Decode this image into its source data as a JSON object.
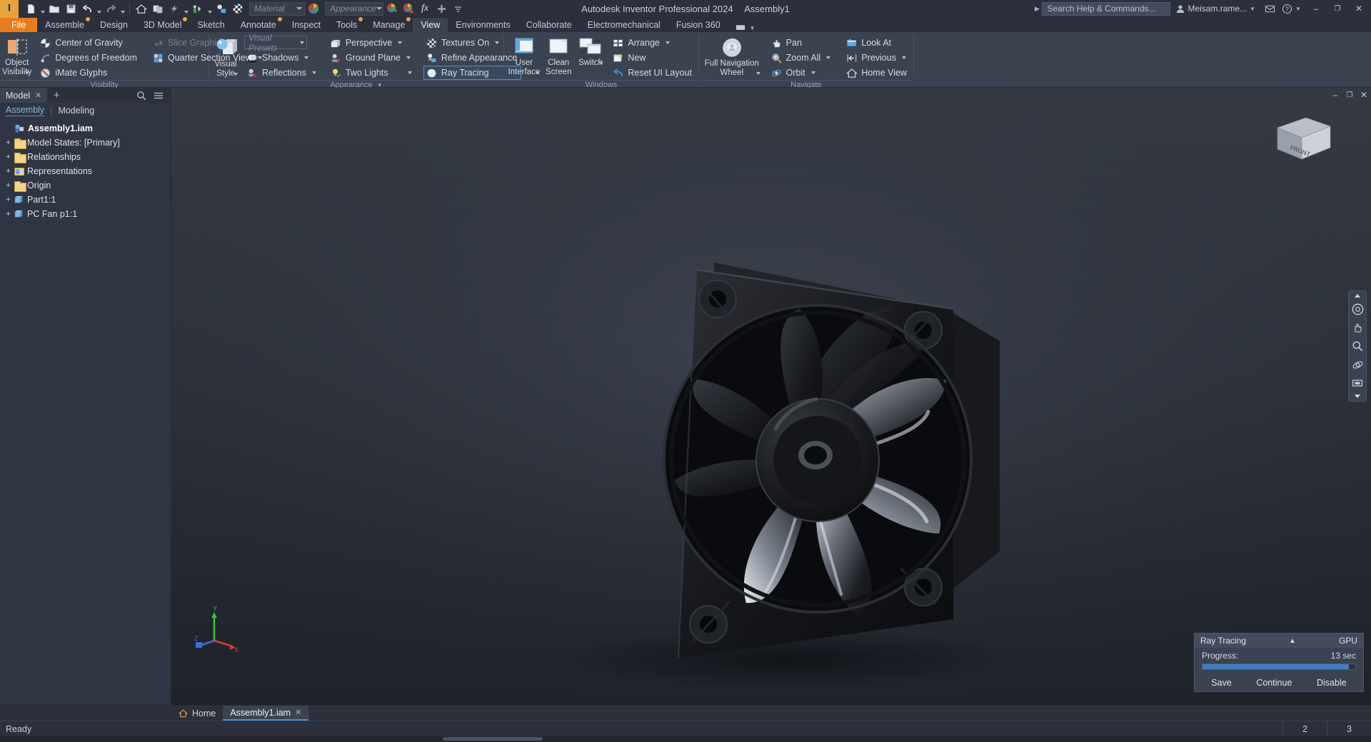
{
  "titlebar": {
    "logo": "I",
    "app_title": "Autodesk Inventor Professional 2024",
    "document_title": "Assembly1",
    "search_placeholder": "Search Help & Commands...",
    "user_name": "Meisam.rame...",
    "material_placeholder": "Material",
    "appearance_placeholder": "Appearance",
    "quick_access": [
      {
        "name": "new-file-icon",
        "label": "New"
      },
      {
        "name": "open-file-icon",
        "label": "Open"
      },
      {
        "name": "save-icon",
        "label": "Save"
      },
      {
        "name": "undo-icon",
        "label": "Undo"
      },
      {
        "name": "redo-icon",
        "label": "Redo"
      },
      {
        "name": "home-icon",
        "label": "Home"
      },
      {
        "name": "return-icon",
        "label": "Return"
      },
      {
        "name": "update-icon",
        "label": "Update"
      },
      {
        "name": "material-swatch-icon",
        "label": "Material Swatch"
      },
      {
        "name": "appearance-swatch-icon",
        "label": "Appearance Swatch"
      },
      {
        "name": "adjust-icon",
        "label": "Adjust"
      },
      {
        "name": "clear-appearance-icon",
        "label": "Clear Appearance"
      },
      {
        "name": "parameters-icon",
        "label": "fx"
      },
      {
        "name": "add-icon",
        "label": "Add"
      },
      {
        "name": "qat-overflow-icon",
        "label": "Customize"
      }
    ],
    "window_controls": {
      "minimize": "–",
      "maximize": "❐",
      "close": "✕"
    }
  },
  "ribbon": {
    "tabs": [
      {
        "label": "File",
        "kind": "file",
        "badge": false
      },
      {
        "label": "Assemble",
        "kind": "normal",
        "badge": true
      },
      {
        "label": "Design",
        "kind": "normal",
        "badge": false
      },
      {
        "label": "3D Model",
        "kind": "normal",
        "badge": true
      },
      {
        "label": "Sketch",
        "kind": "normal",
        "badge": false
      },
      {
        "label": "Annotate",
        "kind": "normal",
        "badge": true
      },
      {
        "label": "Inspect",
        "kind": "normal",
        "badge": false
      },
      {
        "label": "Tools",
        "kind": "normal",
        "badge": true
      },
      {
        "label": "Manage",
        "kind": "normal",
        "badge": true
      },
      {
        "label": "View",
        "kind": "active",
        "badge": false
      },
      {
        "label": "Environments",
        "kind": "normal",
        "badge": false
      },
      {
        "label": "Collaborate",
        "kind": "normal",
        "badge": false
      },
      {
        "label": "Electromechanical",
        "kind": "normal",
        "badge": false
      },
      {
        "label": "Fusion 360",
        "kind": "normal",
        "badge": false
      }
    ],
    "panels": {
      "visibility": {
        "title": "Visibility",
        "object_visibility": "Object\nVisibility",
        "object_visibility_l1": "Object",
        "object_visibility_l2": "Visibility",
        "items": [
          {
            "label": "Center of Gravity",
            "icon": "center-of-gravity-icon",
            "dim": false
          },
          {
            "label": "Degrees of Freedom",
            "icon": "degrees-of-freedom-icon",
            "dim": false
          },
          {
            "label": "iMate Glyphs",
            "icon": "imate-glyphs-icon",
            "dim": false
          },
          {
            "label": "Slice Graphics",
            "icon": "slice-graphics-icon",
            "dim": true
          },
          {
            "label": "Quarter Section View",
            "icon": "quarter-section-view-icon",
            "dim": false
          }
        ]
      },
      "appearance": {
        "title": "Appearance",
        "visual_style_l1": "Visual",
        "visual_style_l2": "Style",
        "visual_presets_placeholder": "Visual Presets",
        "items_col2": [
          {
            "label": "Shadows",
            "icon": "shadows-icon",
            "caret": true,
            "selected": false
          },
          {
            "label": "Reflections",
            "icon": "reflections-icon",
            "caret": true,
            "selected": false
          }
        ],
        "items_col3": [
          {
            "label": "Perspective",
            "icon": "perspective-icon",
            "caret": true,
            "selected": false
          },
          {
            "label": "Ground Plane",
            "icon": "ground-plane-icon",
            "caret": true,
            "selected": false
          },
          {
            "label": "Two Lights",
            "icon": "two-lights-icon",
            "caret": true,
            "selected": false
          }
        ],
        "items_col4": [
          {
            "label": "Textures On",
            "icon": "textures-on-icon",
            "caret": true,
            "selected": false
          },
          {
            "label": "Refine Appearance",
            "icon": "refine-appearance-icon",
            "caret": false,
            "selected": false
          },
          {
            "label": "Ray Tracing",
            "icon": "ray-tracing-icon",
            "caret": false,
            "selected": true
          }
        ]
      },
      "windows": {
        "title": "Windows",
        "user_interface_l1": "User",
        "user_interface_l2": "Interface",
        "clean_screen_l1": "Clean",
        "clean_screen_l2": "Screen",
        "switch_label": "Switch",
        "items": [
          {
            "label": "Arrange",
            "icon": "arrange-icon",
            "caret": true
          },
          {
            "label": "New",
            "icon": "new-window-icon",
            "caret": false
          },
          {
            "label": "Reset UI Layout",
            "icon": "reset-ui-layout-icon",
            "caret": false
          }
        ]
      },
      "navigate": {
        "title": "Navigate",
        "full_nav_l1": "Full Navigation",
        "full_nav_l2": "Wheel",
        "items_col1": [
          {
            "label": "Pan",
            "icon": "pan-icon",
            "caret": false
          },
          {
            "label": "Zoom All",
            "icon": "zoom-all-icon",
            "caret": true
          },
          {
            "label": "Orbit",
            "icon": "orbit-icon",
            "caret": true
          }
        ],
        "items_col2": [
          {
            "label": "Look At",
            "icon": "look-at-icon",
            "caret": false
          },
          {
            "label": "Previous",
            "icon": "previous-view-icon",
            "caret": true
          },
          {
            "label": "Home View",
            "icon": "home-view-icon",
            "caret": false
          }
        ]
      }
    }
  },
  "browser": {
    "tab_label": "Model",
    "close_glyph": "✕",
    "plus_glyph": "+",
    "search_icon": "search-icon",
    "menu_icon": "hamburger-menu-icon",
    "filter_assembly": "Assembly",
    "filter_separator": "|",
    "filter_modeling": "Modeling",
    "tree": [
      {
        "label": "Assembly1.iam",
        "level": 0,
        "expander": "",
        "icon": "assembly-icon",
        "root": true
      },
      {
        "label": "Model States: [Primary]",
        "level": 1,
        "expander": "+",
        "icon": "folder-icon",
        "root": false
      },
      {
        "label": "Relationships",
        "level": 1,
        "expander": "+",
        "icon": "folder-icon",
        "root": false
      },
      {
        "label": "Representations",
        "level": 1,
        "expander": "+",
        "icon": "representations-icon",
        "root": false
      },
      {
        "label": "Origin",
        "level": 1,
        "expander": "+",
        "icon": "folder-icon",
        "root": false
      },
      {
        "label": "Part1:1",
        "level": 1,
        "expander": "+",
        "icon": "part-icon",
        "root": false
      },
      {
        "label": "PC Fan p1:1",
        "level": 1,
        "expander": "+",
        "icon": "part-icon",
        "root": false
      }
    ],
    "panel_controls": {
      "minimize": "–",
      "maximize": "❐",
      "close": "✕"
    }
  },
  "viewport": {
    "viewcube_face": "FRONT",
    "axis_labels": {
      "x": "X",
      "y": "Y",
      "z": "Z"
    },
    "nav_tools": [
      {
        "name": "view-cube-home-icon",
        "glyph": "◎"
      },
      {
        "name": "pan-tool-icon",
        "glyph": "✋"
      },
      {
        "name": "zoom-tool-icon",
        "glyph": "⌕"
      },
      {
        "name": "orbit-tool-icon",
        "glyph": "⥁"
      },
      {
        "name": "look-at-tool-icon",
        "glyph": "▣"
      },
      {
        "name": "nav-more-icon",
        "glyph": "▾"
      }
    ],
    "background_colors": {
      "top": "#30343c",
      "bottom": "#20242b"
    },
    "model_name": "PC Fan"
  },
  "ray_tracing": {
    "title": "Ray Tracing",
    "collapse_glyph": "▲",
    "device": "GPU",
    "progress_label": "Progress:",
    "elapsed": "13 sec",
    "progress_percent": 96,
    "buttons": {
      "save": "Save",
      "continue": "Continue",
      "disable": "Disable"
    }
  },
  "doctabs": [
    {
      "label": "Home",
      "icon": "home-tab-icon",
      "active": false,
      "closable": false
    },
    {
      "label": "Assembly1.iam",
      "icon": "",
      "active": true,
      "closable": true
    }
  ],
  "statusbar": {
    "message": "Ready",
    "cell_1": "2",
    "cell_2": "3"
  },
  "colors": {
    "accent_orange": "#e87d1e",
    "logo_gold": "#e8a33d",
    "selection_blue": "#4b8fc7",
    "panel_bg": "#3b4250",
    "window_bg": "#2b303b",
    "browser_bg": "#2f3542",
    "progress_fill": "#3f7fc0"
  }
}
